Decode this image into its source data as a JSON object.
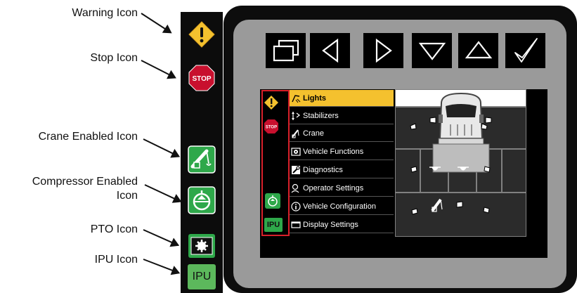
{
  "callouts": {
    "warning": "Warning Icon",
    "stop": "Stop Icon",
    "crane": "Crane Enabled Icon",
    "compressor_line1": "Compressor Enabled",
    "compressor_line2": "Icon",
    "pto": "PTO Icon",
    "ipu": "IPU Icon"
  },
  "strip_icons": {
    "stop_text": "STOP",
    "ipu_text": "IPU"
  },
  "toolbar": [
    "pages-icon",
    "left-triangle-icon",
    "right-triangle-icon",
    "down-triangle-icon",
    "up-triangle-icon",
    "checkmark-icon"
  ],
  "screen": {
    "sidebar": {
      "stop_text": "STOP",
      "ipu_text": "IPU"
    },
    "menu": [
      {
        "label": "Lights",
        "icon": "lights-icon",
        "active": true
      },
      {
        "label": "Stabilizers",
        "icon": "stabilizers-icon",
        "active": false
      },
      {
        "label": "Crane",
        "icon": "crane-icon",
        "active": false
      },
      {
        "label": "Vehicle Functions",
        "icon": "vehicle-functions-icon",
        "active": false
      },
      {
        "label": "Diagnostics",
        "icon": "diagnostics-icon",
        "active": false
      },
      {
        "label": "Operator Settings",
        "icon": "operator-icon",
        "active": false
      },
      {
        "label": "Vehicle Configuration",
        "icon": "info-icon",
        "active": false
      },
      {
        "label": "Display Settings",
        "icon": "display-icon",
        "active": false
      }
    ]
  },
  "colors": {
    "warning": "#f4c12e",
    "stop": "#c8102e",
    "enabled_green": "#2ea84a",
    "ipu_green": "#5cb85c",
    "highlight": "#f4c12e",
    "callout_box": "#d8202a"
  }
}
